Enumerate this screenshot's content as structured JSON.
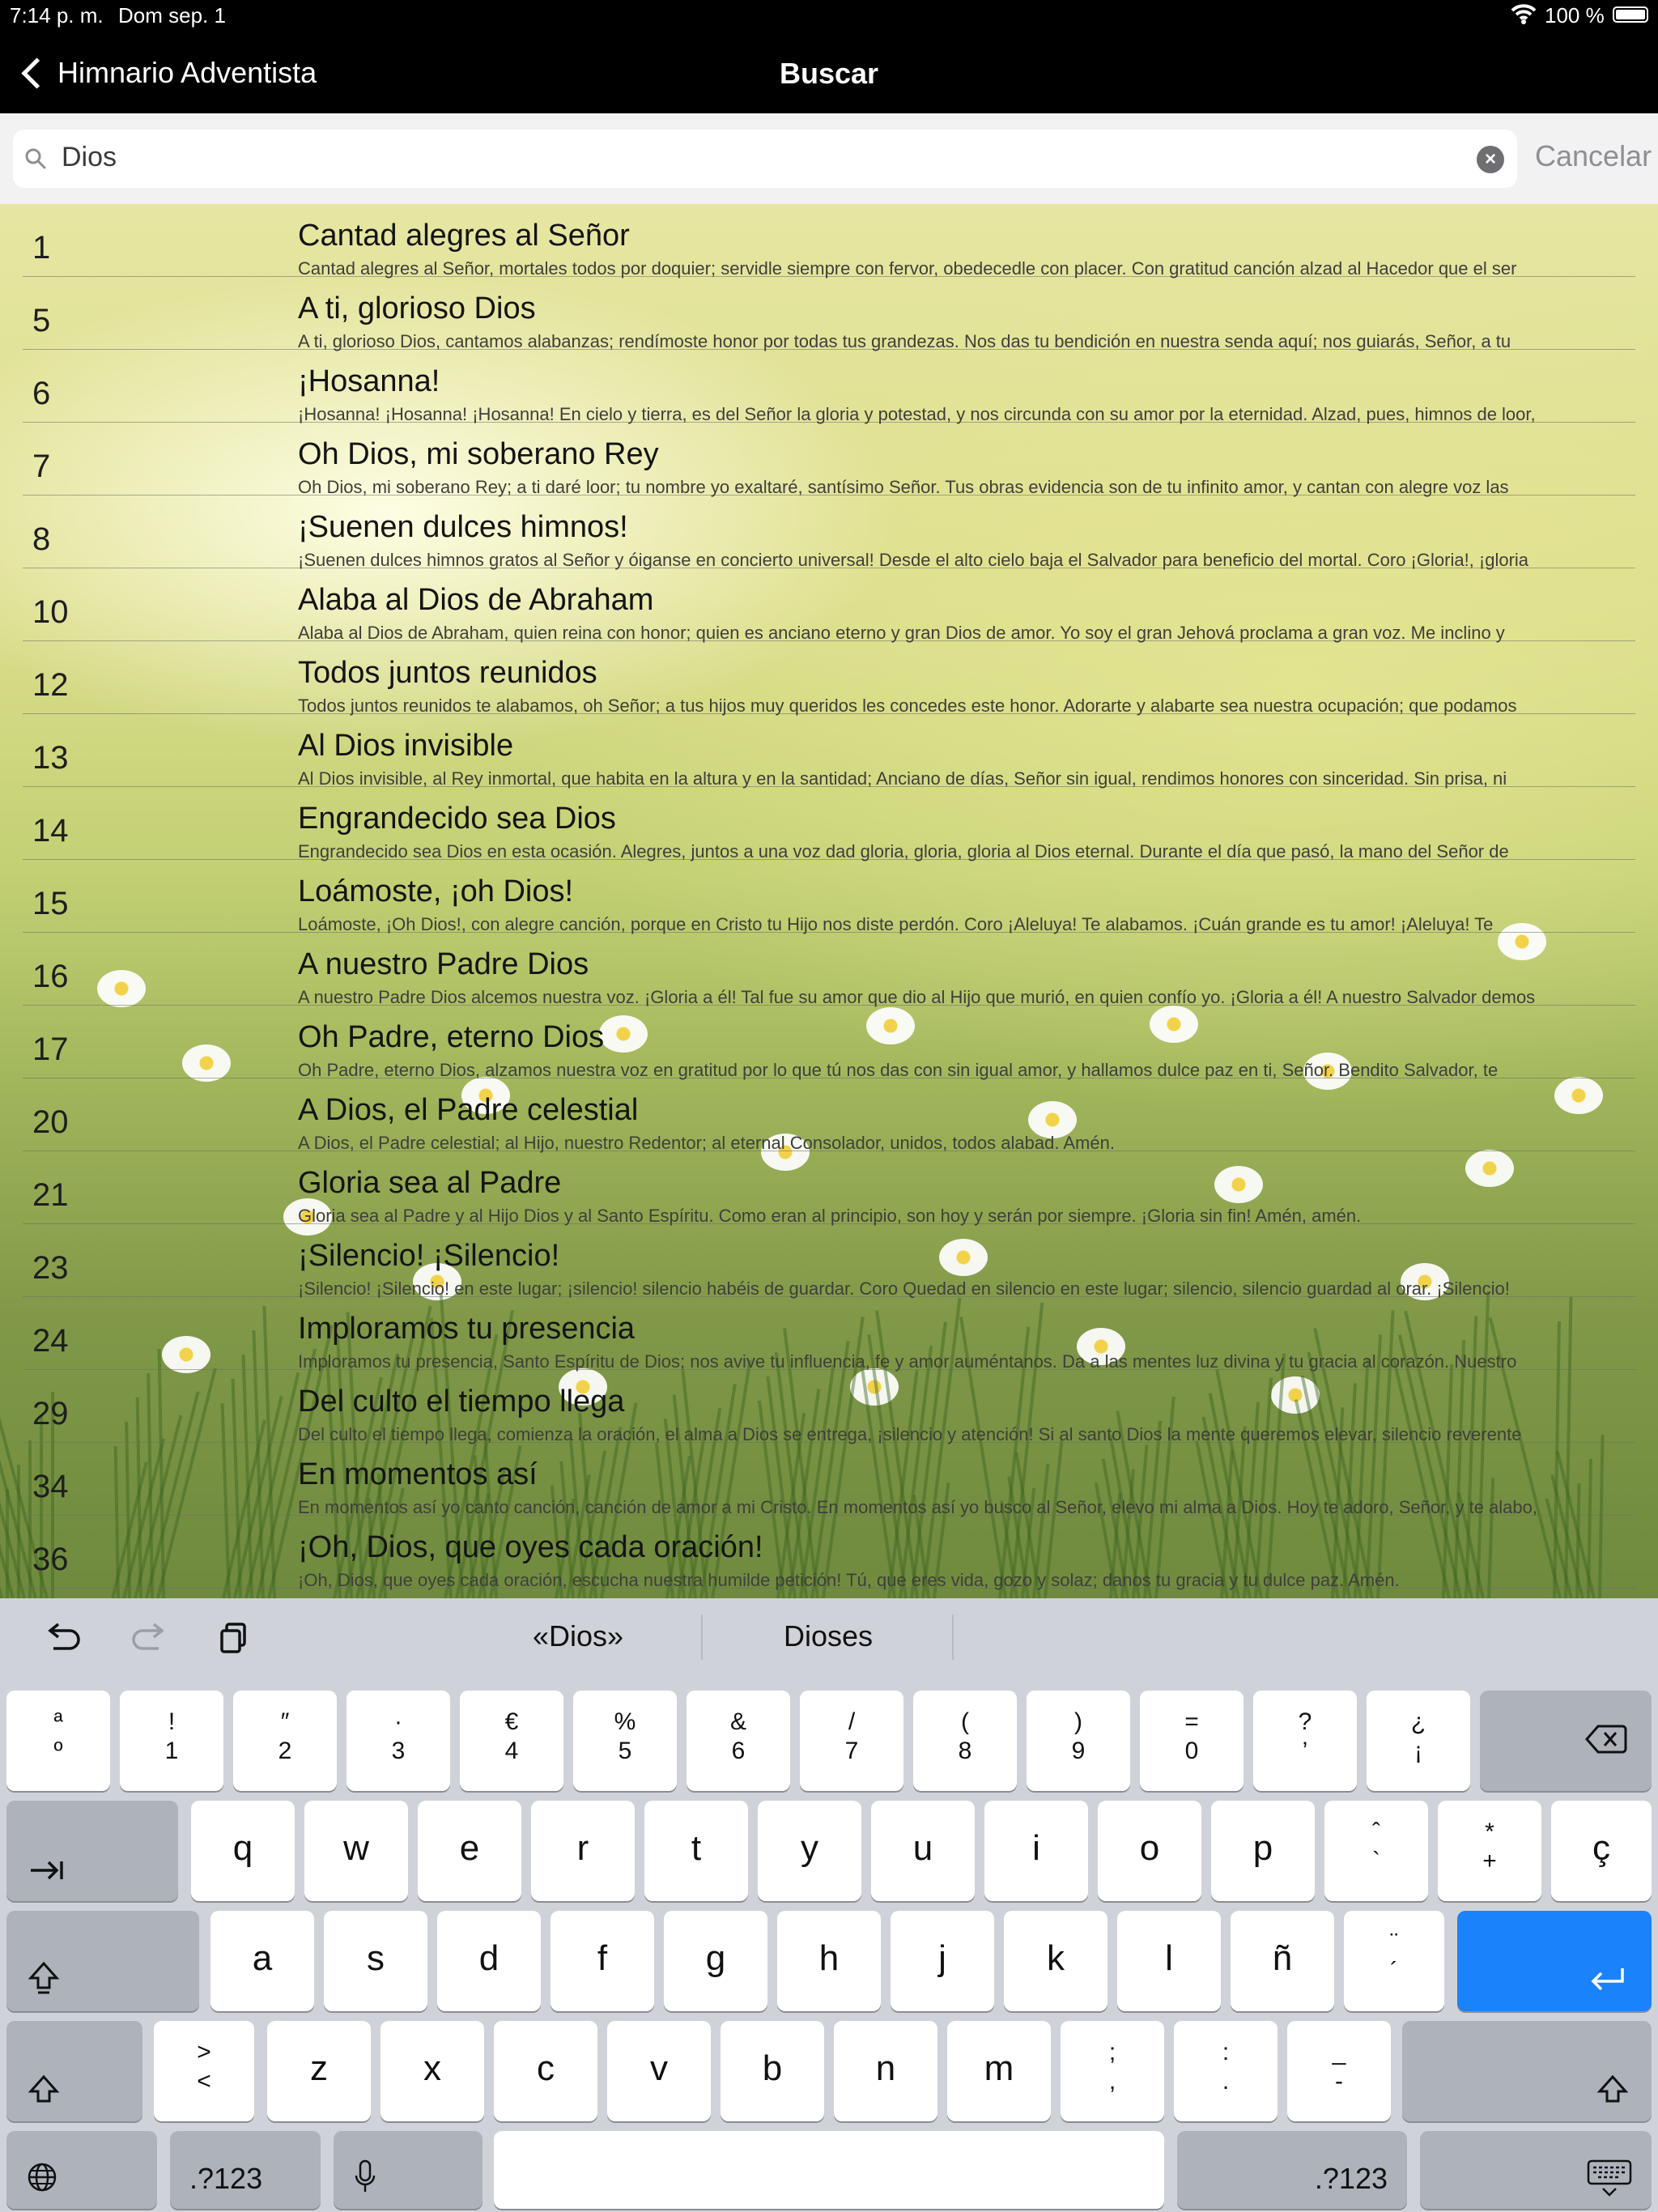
{
  "status_bar": {
    "time": "7:14 p. m.",
    "date": "Dom sep. 1",
    "battery": "100 %"
  },
  "nav": {
    "back_label": "Himnario Adventista",
    "title": "Buscar"
  },
  "search": {
    "value": "Dios",
    "cancel_label": "Cancelar"
  },
  "results": [
    {
      "num": "1",
      "title": "Cantad alegres al Señor",
      "lyrics": "Cantad alegres al Señor, mortales todos por doquier; servidle siempre con fervor, obedecedle con placer.  Con gratitud canción alzad al Hacedor que el ser"
    },
    {
      "num": "5",
      "title": "A ti, glorioso Dios",
      "lyrics": "A ti, glorioso Dios, cantamos alabanzas; rendímoste honor por todas tus grandezas. Nos das tu bendición en nuestra senda aquí; nos guiarás, Señor, a tu"
    },
    {
      "num": "6",
      "title": "¡Hosanna!",
      "lyrics": "¡Hosanna! ¡Hosanna! ¡Hosanna! En cielo y tierra, es del Señor la gloria y potestad, y nos circunda con su amor por la eternidad. Alzad, pues, himnos de loor,"
    },
    {
      "num": "7",
      "title": "Oh Dios, mi soberano Rey",
      "lyrics": "Oh Dios, mi soberano Rey; a ti daré loor; tu nombre yo exaltaré, santísimo Señor.  Tus obras evidencia son de tu infinito amor, y cantan con alegre voz las"
    },
    {
      "num": "8",
      "title": "¡Suenen dulces himnos!",
      "lyrics": "¡Suenen dulces himnos gratos al Señor y óiganse en concierto universal! Desde el alto cielo baja el Salvador para beneficio del mortal.  Coro ¡Gloria!, ¡gloria"
    },
    {
      "num": "10",
      "title": "Alaba al Dios de Abraham",
      "lyrics": "Alaba al Dios de Abraham, quien reina con honor; quien es anciano eterno y gran Dios de amor. Yo soy el gran Jehová proclama a gran voz. Me inclino y"
    },
    {
      "num": "12",
      "title": "Todos juntos reunidos",
      "lyrics": "Todos juntos reunidos te alabamos, oh Señor; a tus hijos muy queridos les concedes este honor. Adorarte y alabarte sea nuestra ocupación; que podamos"
    },
    {
      "num": "13",
      "title": "Al Dios invisible",
      "lyrics": "Al Dios invisible, al Rey inmortal, que habita en la altura y en la santidad; Anciano de días, Señor sin igual, rendimos honores con sinceridad.  Sin prisa, ni"
    },
    {
      "num": "14",
      "title": "Engrandecido sea Dios",
      "lyrics": "Engrandecido sea Dios en esta ocasión. Alegres, juntos a una voz dad gloria, gloria, gloria al Dios eternal.  Durante el día que pasó, la mano del Señor de"
    },
    {
      "num": "15",
      "title": "Loámoste, ¡oh Dios!",
      "lyrics": "Loámoste, ¡Oh Dios!, con alegre canción, porque en Cristo tu Hijo nos diste perdón.  Coro ¡Aleluya! Te alabamos. ¡Cuán grande es tu amor! ¡Aleluya! Te"
    },
    {
      "num": "16",
      "title": "A nuestro Padre Dios",
      "lyrics": "A nuestro Padre Dios alcemos nuestra voz. ¡Gloria a él! Tal fue su amor que dio al Hijo que murió, en quien confío yo. ¡Gloria a él!  A nuestro Salvador demos"
    },
    {
      "num": "17",
      "title": "Oh Padre, eterno Dios",
      "lyrics": "Oh Padre, eterno Dios, alzamos nuestra voz en gratitud por lo que tú nos das con sin igual amor, y hallamos dulce paz en ti, Señor.  Bendito Salvador, te"
    },
    {
      "num": "20",
      "title": "A Dios, el Padre celestial",
      "lyrics": "A Dios, el Padre celestial; al Hijo, nuestro Redentor; al eternal Consolador, unidos, todos alabad. Amén."
    },
    {
      "num": "21",
      "title": "Gloria sea al Padre",
      "lyrics": "Gloria sea al Padre y al Hijo Dios y al Santo Espíritu. Como eran al principio, son hoy y serán por siempre. ¡Gloria sin fin! Amén, amén."
    },
    {
      "num": "23",
      "title": "¡Silencio! ¡Silencio!",
      "lyrics": "¡Silencio! ¡Silencio! en este lugar; ¡silencio! silencio habéis de guardar.  Coro Quedad en silencio en este lugar; silencio, silencio guardad al orar.  ¡Silencio!"
    },
    {
      "num": "24",
      "title": "Imploramos tu presencia",
      "lyrics": "Imploramos tu presencia, Santo Espíritu de Dios; nos avive tu influencia, fe y amor auméntanos.  Da a las mentes luz divina y tu gracia al corazón. Nuestro"
    },
    {
      "num": "29",
      "title": "Del culto el tiempo llega",
      "lyrics": "Del culto el tiempo llega, comienza la oración, el alma a Dios se entrega, ¡silencio y atención! Si al santo Dios la mente queremos elevar, silencio reverente"
    },
    {
      "num": "34",
      "title": "En momentos así",
      "lyrics": "En momentos así yo canto canción, canción de amor a mi Cristo. En momentos así yo busco al Señor, elevo mi alma a Dios. Hoy te adoro, Señor, y te alabo,"
    },
    {
      "num": "36",
      "title": "¡Oh, Dios, que oyes cada oración!",
      "lyrics": "¡Oh, Dios, que oyes cada oración, escucha nuestra humilde petición! Tú, que eres vida, gozo y solaz; danos tu gracia y tu dulce paz. Amén."
    }
  ],
  "keyboard": {
    "suggestions": [
      "«Dios»",
      "Dioses"
    ],
    "toolbar_icons": [
      "undo-icon",
      "redo-icon",
      "clipboard-icon"
    ],
    "row1": [
      {
        "top": "ª",
        "bottom": "º"
      },
      {
        "top": "!",
        "bottom": "1"
      },
      {
        "top": "″",
        "bottom": "2"
      },
      {
        "top": "·",
        "bottom": "3"
      },
      {
        "top": "€",
        "bottom": "4"
      },
      {
        "top": "%",
        "bottom": "5"
      },
      {
        "top": "&",
        "bottom": "6"
      },
      {
        "top": "/",
        "bottom": "7"
      },
      {
        "top": "(",
        "bottom": "8"
      },
      {
        "top": ")",
        "bottom": "9"
      },
      {
        "top": "=",
        "bottom": "0"
      },
      {
        "top": "?",
        "bottom": "’"
      },
      {
        "top": "¿",
        "bottom": "¡"
      }
    ],
    "row2": [
      "q",
      "w",
      "e",
      "r",
      "t",
      "y",
      "u",
      "i",
      "o",
      "p"
    ],
    "row2_extra": [
      {
        "top": "ˆ",
        "bottom": "`"
      },
      {
        "top": "*",
        "bottom": "+"
      },
      {
        "main": "ç"
      }
    ],
    "row3": [
      "a",
      "s",
      "d",
      "f",
      "g",
      "h",
      "j",
      "k",
      "l",
      "ñ"
    ],
    "row3_extra": {
      "top": "¨",
      "bottom": "´"
    },
    "row4_first": {
      "top": ">",
      "bottom": "<"
    },
    "row4": [
      "z",
      "x",
      "c",
      "v",
      "b",
      "n",
      "m"
    ],
    "row4_extra": [
      {
        "top": ";",
        "bottom": ","
      },
      {
        "top": ":",
        "bottom": "."
      },
      {
        "top": "_",
        "bottom": "-"
      }
    ],
    "numbers_label": ".?123",
    "icons": {
      "delete": "delete-icon",
      "tab": "tab-icon",
      "shift": "shift-icon",
      "return": "return-icon",
      "globe": "globe-icon",
      "mic": "microphone-icon",
      "hide": "keyboard-dismiss-icon"
    }
  }
}
